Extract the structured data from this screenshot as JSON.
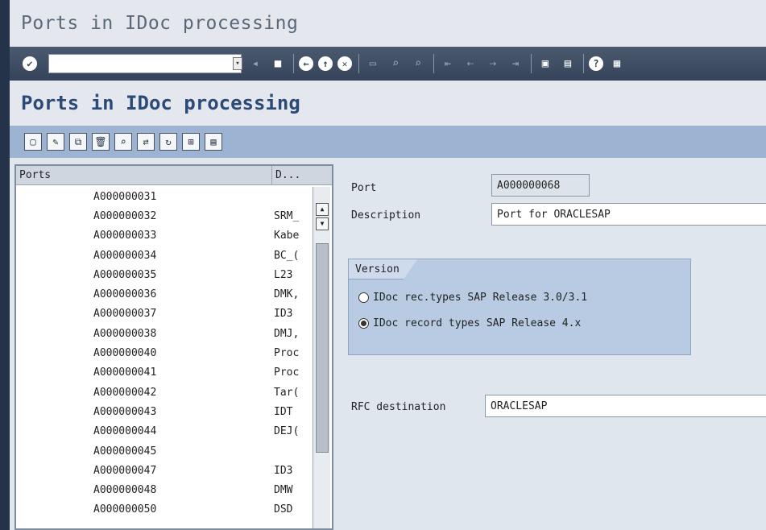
{
  "window": {
    "title": "Ports in IDoc processing"
  },
  "app": {
    "header": "Ports in IDoc processing"
  },
  "list": {
    "col_port": "Ports",
    "col_desc": "D...",
    "rows": [
      {
        "port": "A000000031",
        "desc": ""
      },
      {
        "port": "A000000032",
        "desc": "SRM_"
      },
      {
        "port": "A000000033",
        "desc": "Kabe"
      },
      {
        "port": "A000000034",
        "desc": "BC_("
      },
      {
        "port": "A000000035",
        "desc": "L23"
      },
      {
        "port": "A000000036",
        "desc": "DMK,"
      },
      {
        "port": "A000000037",
        "desc": "ID3"
      },
      {
        "port": "A000000038",
        "desc": "DMJ,"
      },
      {
        "port": "A000000040",
        "desc": "Proc"
      },
      {
        "port": "A000000041",
        "desc": "Proc"
      },
      {
        "port": "A000000042",
        "desc": "Tar("
      },
      {
        "port": "A000000043",
        "desc": "IDT"
      },
      {
        "port": "A000000044",
        "desc": "DEJ("
      },
      {
        "port": "A000000045",
        "desc": ""
      },
      {
        "port": "A000000047",
        "desc": "ID3"
      },
      {
        "port": "A000000048",
        "desc": "DMW"
      },
      {
        "port": "A000000050",
        "desc": "DSD"
      }
    ]
  },
  "form": {
    "port_label": "Port",
    "port_value": "A000000068",
    "description_label": "Description",
    "description_value": "Port for ORACLESAP",
    "version_title": "Version",
    "version_option_1": "IDoc rec.types SAP Release 3.0/3.1",
    "version_option_2": "IDoc record types SAP Release 4.x",
    "rfc_label": "RFC destination",
    "rfc_value": "ORACLESAP"
  }
}
